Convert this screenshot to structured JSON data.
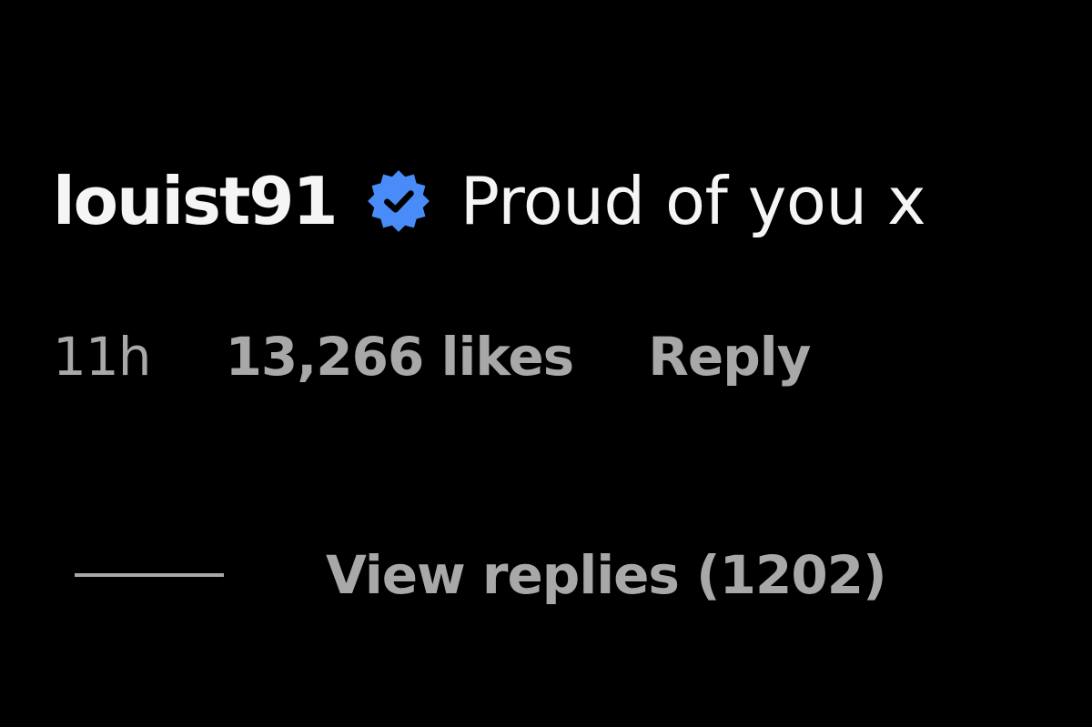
{
  "comment": {
    "username": "louist91",
    "verified_badge_icon": "verified-badge-icon",
    "text": "Proud of you x",
    "time": "11h",
    "likes": "13,266 likes",
    "reply_label": "Reply",
    "view_replies_label": "View replies (1202)"
  },
  "colors": {
    "background": "#000000",
    "primary_text": "#f5f5f5",
    "secondary_text": "#a8a8a8",
    "verified_blue": "#4a8cf7"
  }
}
